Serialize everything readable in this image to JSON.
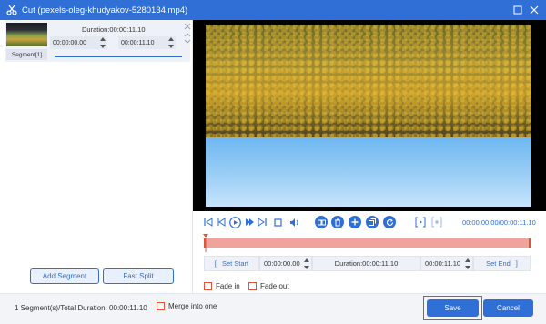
{
  "window": {
    "title": "Cut (pexels-oleg-khudyakov-5280134.mp4)",
    "app_icon": "scissors-icon",
    "buttons": [
      "restore-icon",
      "close-icon"
    ]
  },
  "segments": [
    {
      "label": "Segment[1]",
      "duration_text": "Duration:00:00:11.10",
      "start": "00:00:00.00",
      "end": "00:00:11.10"
    }
  ],
  "left_actions": {
    "add_segment": "Add Segment",
    "fast_split": "Fast Split"
  },
  "player": {
    "current_time": "00:00:00.00",
    "total_time": "/00:00:11.10",
    "controls": [
      "skip-start-icon",
      "frame-back-icon",
      "play-icon",
      "frame-forward-icon",
      "skip-end-icon",
      "stop-icon",
      "volume-icon",
      "segment-copy-icon",
      "delete-icon",
      "add-icon",
      "duplicate-icon",
      "reset-icon",
      "snap-start-icon",
      "snap-end-icon"
    ]
  },
  "range": {
    "set_start": "Set Start",
    "start_value": "00:00:00.00",
    "duration_text": "Duration:00:00:11.10",
    "end_value": "00:00:11.10",
    "set_end": "Set End",
    "timeline_fill_fraction": 1.0
  },
  "effects": {
    "fade_in": "Fade in",
    "fade_out": "Fade out"
  },
  "footer": {
    "summary": "1 Segment(s)/Total Duration: 00:00:11.10",
    "merge_label": "Merge into one",
    "save": "Save",
    "cancel": "Cancel"
  },
  "colors": {
    "accent": "#2f6fd6",
    "timeline": "#f0a39a",
    "timeline_edge": "#e0543c",
    "highlight": "#e0413a"
  }
}
